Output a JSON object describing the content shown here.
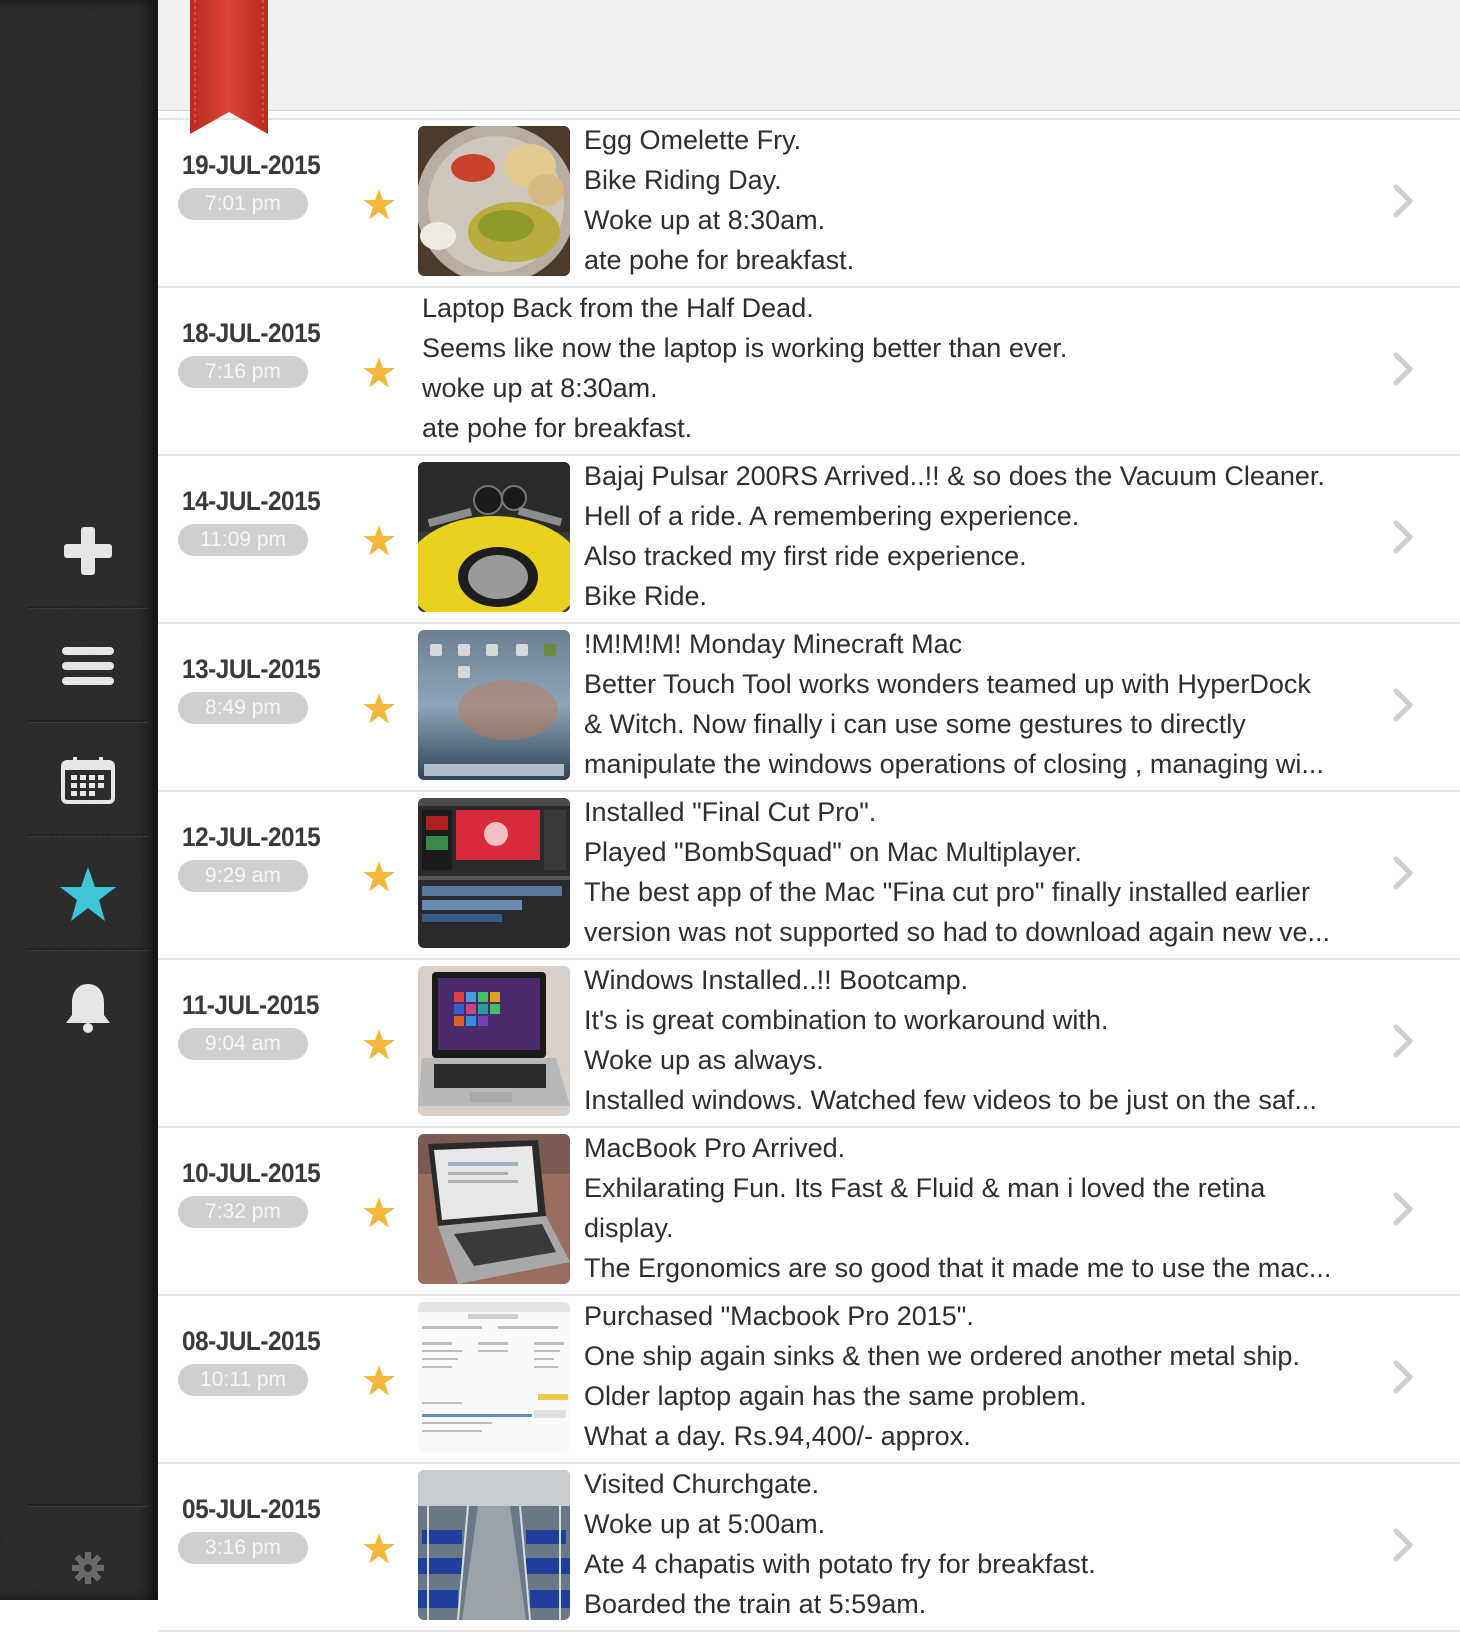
{
  "sidebar": {
    "icons": [
      "plus-icon",
      "menu-icon",
      "calendar-icon",
      "star-icon",
      "bell-icon",
      "gear-icon"
    ],
    "active_color": "#3ec6d8",
    "icon_color": "#e6e6e6"
  },
  "accent": {
    "bookmark": "#d23b2e",
    "star": "#f3b73b"
  },
  "entries": [
    {
      "date": "19-JUL-2015",
      "time": "7:01 pm",
      "starred": true,
      "thumbnail": "food",
      "lines": [
        "Egg Omelette Fry.",
        "Bike Riding Day.",
        "Woke up at 8:30am.",
        "ate pohe for breakfast."
      ]
    },
    {
      "date": "18-JUL-2015",
      "time": "7:16 pm",
      "starred": true,
      "thumbnail": null,
      "lines": [
        "Laptop Back from the Half Dead.",
        "Seems like now the laptop is working better than ever.",
        "woke up at 8:30am.",
        "ate pohe for breakfast."
      ]
    },
    {
      "date": "14-JUL-2015",
      "time": "11:09 pm",
      "starred": true,
      "thumbnail": "bike",
      "lines": [
        "Bajaj Pulsar 200RS Arrived..!! & so does the Vacuum Cleaner.",
        "Hell of a ride. A remembering experience.",
        "Also tracked my first ride experience.",
        "Bike Ride."
      ]
    },
    {
      "date": "13-JUL-2015",
      "time": "8:49 pm",
      "starred": true,
      "thumbnail": "desktop",
      "lines": [
        "!M!M!M! Monday Minecraft Mac",
        "Better Touch Tool works wonders teamed up with HyperDock",
        "& Witch. Now finally i can use some gestures to directly",
        "manipulate the windows operations of closing , managing wi..."
      ]
    },
    {
      "date": "12-JUL-2015",
      "time": "9:29 am",
      "starred": true,
      "thumbnail": "video-editor",
      "lines": [
        "Installed \"Final Cut Pro\".",
        "Played \"BombSquad\" on Mac Multiplayer.",
        "The best app of the Mac \"Fina cut pro\" finally installed earlier",
        "version was not supported so had to download again new ve..."
      ]
    },
    {
      "date": "11-JUL-2015",
      "time": "9:04 am",
      "starred": true,
      "thumbnail": "laptop-windows",
      "lines": [
        "Windows Installed..!! Bootcamp.",
        "It's is great combination to workaround with.",
        "Woke up as always.",
        "Installed windows. Watched few videos to be just on the saf..."
      ]
    },
    {
      "date": "10-JUL-2015",
      "time": "7:32 pm",
      "starred": true,
      "thumbnail": "macbook",
      "lines": [
        "MacBook Pro Arrived.",
        "Exhilarating Fun. Its Fast & Fluid & man i loved the retina",
        "display.",
        "The Ergonomics are so good that it made me to use the mac..."
      ]
    },
    {
      "date": "08-JUL-2015",
      "time": "10:11 pm",
      "starred": true,
      "thumbnail": "receipt",
      "lines": [
        "Purchased \"Macbook Pro 2015\".",
        "One ship again sinks & then we ordered another metal ship.",
        "Older laptop again has the same problem.",
        "What a day. Rs.94,400/- approx."
      ]
    },
    {
      "date": "05-JUL-2015",
      "time": "3:16 pm",
      "starred": true,
      "thumbnail": "train",
      "lines": [
        "Visited Churchgate.",
        "Woke up at 5:00am.",
        "Ate 4 chapatis with potato fry for breakfast.",
        "Boarded the train at 5:59am."
      ]
    }
  ]
}
